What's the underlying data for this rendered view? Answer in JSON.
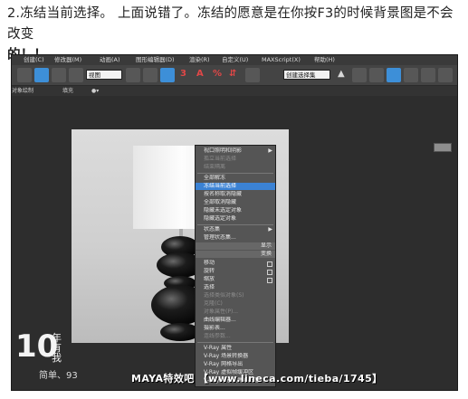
{
  "post": {
    "line1": "2.冻结当前选择。 上面说错了。冻结的愿意是在你按F3的时候背景图是不会改变",
    "line2": "的！！"
  },
  "menubar": {
    "items": [
      "创建(C)",
      "修改器(M)",
      "动画(A)",
      "图形编辑器(D)",
      "渲染(R)",
      "自定义(U)",
      "MAXScript(X)",
      "帮助(H)"
    ]
  },
  "toolbar": {
    "view_combo": "视图",
    "selection_set_combo": "创建选择集"
  },
  "subbar": {
    "left": "对象绘制",
    "middle": "填充",
    "small": "●▾"
  },
  "quad_menu": {
    "items": [
      {
        "label": "视口照明和阴影",
        "state": "submenu"
      },
      {
        "label": "孤立当前选择",
        "state": "dim"
      },
      {
        "label": "结束隔离",
        "state": "dim"
      },
      {
        "label": "全部解冻",
        "state": "normal"
      },
      {
        "label": "冻结当前选择",
        "state": "selected"
      },
      {
        "label": "按名称取消隐藏",
        "state": "normal"
      },
      {
        "label": "全部取消隐藏",
        "state": "normal"
      },
      {
        "label": "隐藏未选定对象",
        "state": "normal"
      },
      {
        "label": "隐藏选定对象",
        "state": "normal"
      },
      {
        "label": "状态集",
        "state": "submenu"
      },
      {
        "label": "管理状态集...",
        "state": "normal"
      },
      {
        "label": "显示",
        "state": "header"
      },
      {
        "label": "变换",
        "state": "header"
      },
      {
        "label": "移动",
        "state": "box"
      },
      {
        "label": "旋转",
        "state": "box"
      },
      {
        "label": "缩放",
        "state": "box"
      },
      {
        "label": "选择",
        "state": "normal"
      },
      {
        "label": "选择类似对象(S)",
        "state": "dim"
      },
      {
        "label": "克隆(C)",
        "state": "dim"
      },
      {
        "label": "对象属性(P)...",
        "state": "dim"
      },
      {
        "label": "曲线编辑器...",
        "state": "normal"
      },
      {
        "label": "摄影表...",
        "state": "normal"
      },
      {
        "label": "连线参数...",
        "state": "normal"
      },
      {
        "label": "V-Ray 属性",
        "state": "normal"
      },
      {
        "label": "V-Ray 场景转换器",
        "state": "normal"
      },
      {
        "label": "V-Ray 网格导出",
        "state": "normal"
      },
      {
        "label": "V-Ray 虚拟帧缓冲区",
        "state": "normal"
      },
      {
        "label": "V-Ray 场景文件导出器",
        "state": "normal"
      }
    ]
  },
  "watermark": {
    "logo": "10",
    "sub": "年有我",
    "user": "简单、93",
    "site": "MAYA特效吧 【www.lineca.com/tieba/1745】"
  },
  "colors": {
    "selection": "#3b82d4",
    "menu_bg": "#555555",
    "toolbar_accent": "#3d8fd8"
  }
}
